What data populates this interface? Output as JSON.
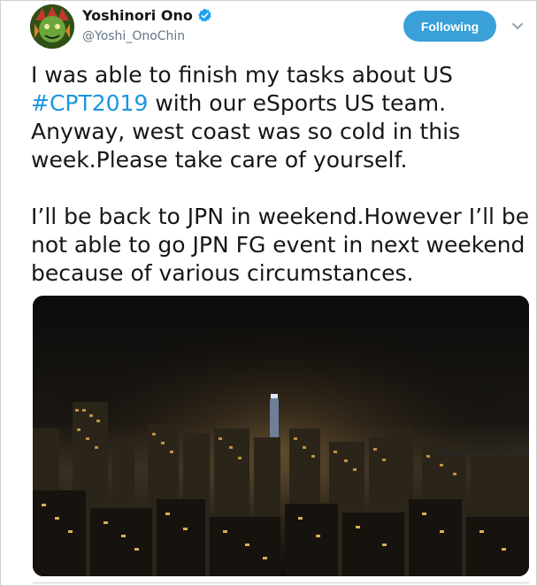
{
  "header": {
    "display_name": "Yoshinori Ono",
    "handle": "@Yoshi_OnoChin",
    "follow_label": "Following"
  },
  "tweet": {
    "line1_before": "I was able to finish my tasks about US ",
    "hashtag": "#CPT2019",
    "line1_after": " with our eSports US team. Anyway, west coast was so cold in this week.Please take care of yourself.",
    "paragraph2": "I’ll be back to JPN in weekend.However I’ll be not able to go JPN FG event in next weekend because of various circumstances."
  },
  "colors": {
    "accent": "#1b95e0",
    "button": "#3aa0d9"
  },
  "icons": {
    "verified": "verified-badge-icon",
    "caret": "chevron-down-icon"
  }
}
